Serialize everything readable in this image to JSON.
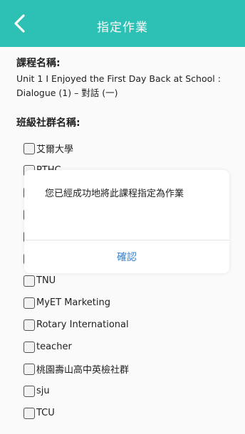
{
  "header": {
    "title": "指定作業",
    "back_icon": "chevron-left-icon"
  },
  "course": {
    "label": "課程名稱:",
    "name": "Unit 1 I Enjoyed the First Day Back at School : Dialogue (1) – 對話 (一)"
  },
  "groups": {
    "label": "班級社群名稱:",
    "items": [
      {
        "label": "艾爾大學"
      },
      {
        "label": "PTHC"
      },
      {
        "label": ""
      },
      {
        "label": ""
      },
      {
        "label": ""
      },
      {
        "label": ""
      },
      {
        "label": "TNU"
      },
      {
        "label": "MyET Marketing"
      },
      {
        "label": "Rotary International"
      },
      {
        "label": "teacher"
      },
      {
        "label": "桃園壽山高中英檢社群"
      },
      {
        "label": "sju"
      },
      {
        "label": "TCU"
      }
    ]
  },
  "dialog": {
    "message": "您已經成功地將此課程指定為作業",
    "confirm_label": "確認"
  },
  "colors": {
    "header_bg": "#2ec4b8",
    "confirm_text": "#3c82c9"
  }
}
